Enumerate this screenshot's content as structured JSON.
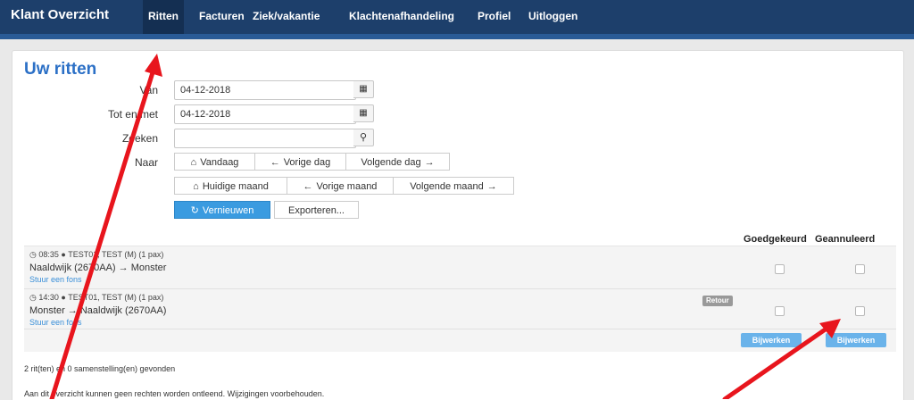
{
  "navbar": {
    "brand": "Klant Overzicht",
    "items": [
      {
        "label": "Ritten",
        "active": true
      },
      {
        "label": "Facturen",
        "active": false
      },
      {
        "label": "Ziek/vakantie",
        "active": false
      },
      {
        "label": "Klachtenafhandeling",
        "active": false
      },
      {
        "label": "Profiel",
        "active": false
      },
      {
        "label": "Uitloggen",
        "active": false
      }
    ]
  },
  "page": {
    "title": "Uw ritten"
  },
  "filters": {
    "van_label": "Van",
    "van_value": "04-12-2018",
    "tot_label": "Tot en met",
    "tot_value": "04-12-2018",
    "zoeken_label": "Zoeken",
    "zoeken_value": "",
    "naar_label": "Naar"
  },
  "nav_buttons": {
    "vandaag": "Vandaag",
    "vorige_dag": "Vorige dag",
    "volgende_dag": "Volgende dag",
    "huidige_maand": "Huidige maand",
    "vorige_maand": "Vorige maand",
    "volgende_maand": "Volgende maand"
  },
  "actions": {
    "vernieuwen": "Vernieuwen",
    "exporteren": "Exporteren..."
  },
  "columns": {
    "goedgekeurd": "Goedgekeurd",
    "geannuleerd": "Geannuleerd"
  },
  "rides": [
    {
      "time": "08:35",
      "passenger": "TEST01, TEST (M) (1 pax)",
      "route": "Naaldwijk (2670AA) → Monster",
      "link": "Stuur een fons",
      "badge": "",
      "goedgekeurd": false,
      "geannuleerd": false
    },
    {
      "time": "14:30",
      "passenger": "TEST01, TEST (M) (1 pax)",
      "route": "Monster → Naaldwijk (2670AA)",
      "link": "Stuur een fons",
      "badge": "Retour",
      "goedgekeurd": false,
      "geannuleerd": false
    }
  ],
  "update_buttons": {
    "goedgekeurd": "Bijwerken",
    "geannuleerd": "Bijwerken"
  },
  "footer": {
    "count": "2 rit(ten) en 0 samenstelling(en) gevonden",
    "disclaimer": "Aan dit overzicht kunnen geen rechten worden ontleend. Wijzigingen voorbehouden."
  },
  "colors": {
    "navbar": "#1d3f6b",
    "accent": "#2c70c6",
    "primary_button": "#3a9be0",
    "annotation_arrow": "#e8151d"
  }
}
